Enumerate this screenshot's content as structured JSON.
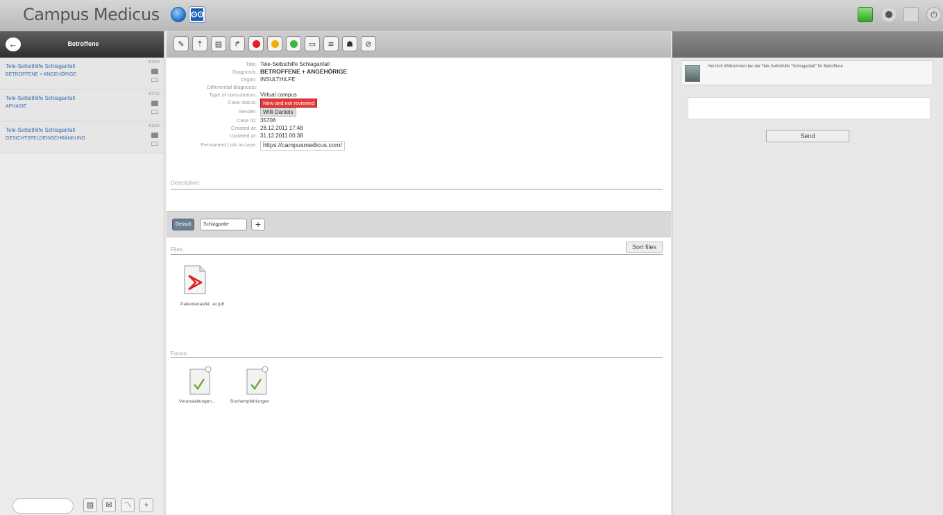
{
  "header": {
    "app_title": "Campus Medicus"
  },
  "sidebar": {
    "title": "Betroffene",
    "cases": [
      {
        "title": "Tele-Selbsthilfe Schlaganfall",
        "sub": "BETROFFENE + ANGEHÖRIGE",
        "num": "40916"
      },
      {
        "title": "Tele-Selbsthilfe Schlaganfall",
        "sub": "APHASIE",
        "num": "40712"
      },
      {
        "title": "Tele-Selbsthilfe Schlaganfall",
        "sub": "GESICHTSFELDEINSCHRÄNKUNG",
        "num": "40530"
      }
    ]
  },
  "details": {
    "title_label": "Title:",
    "title": "Tele-Selbsthilfe Schlaganfall",
    "diagnosis_label": "Diagnosis:",
    "diagnosis": "BETROFFENE + ANGEHÖRIGE",
    "organ_label": "Organ:",
    "organ": "INSULTHILFE",
    "differential_label": "Differential diagnosis:",
    "differential": "",
    "consult_label": "Type of consultation:",
    "consult": "Virtual campus",
    "status_label": "Case status:",
    "status": "New and not reviewed",
    "sender_label": "Sender:",
    "sender": "Willi Daniels",
    "caseid_label": "Case ID:",
    "caseid": "35708",
    "created_label": "Created at:",
    "created": "28.12.2011 17:48",
    "updated_label": "Updated at:",
    "updated": "31.12.2011 00:38",
    "permalink_label": "Permanent Link to case:",
    "permalink": "https://campusmedicus.com/"
  },
  "description_label": "Description:",
  "tabs": {
    "default": "Default",
    "second": "Schlagpatie"
  },
  "files": {
    "label": "Files:",
    "sort": "Sort files",
    "items": [
      "Patientenaufkl...er.pdf"
    ]
  },
  "forms": {
    "label": "Forms:",
    "items": [
      "Veranstaltungen...",
      "Buchempfehlungen"
    ]
  },
  "chat": {
    "message": "Herzlich Willkommen bei der Tele-Selbsthilfe \"Schlaganfall\" für Betroffene",
    "send": "Send"
  }
}
